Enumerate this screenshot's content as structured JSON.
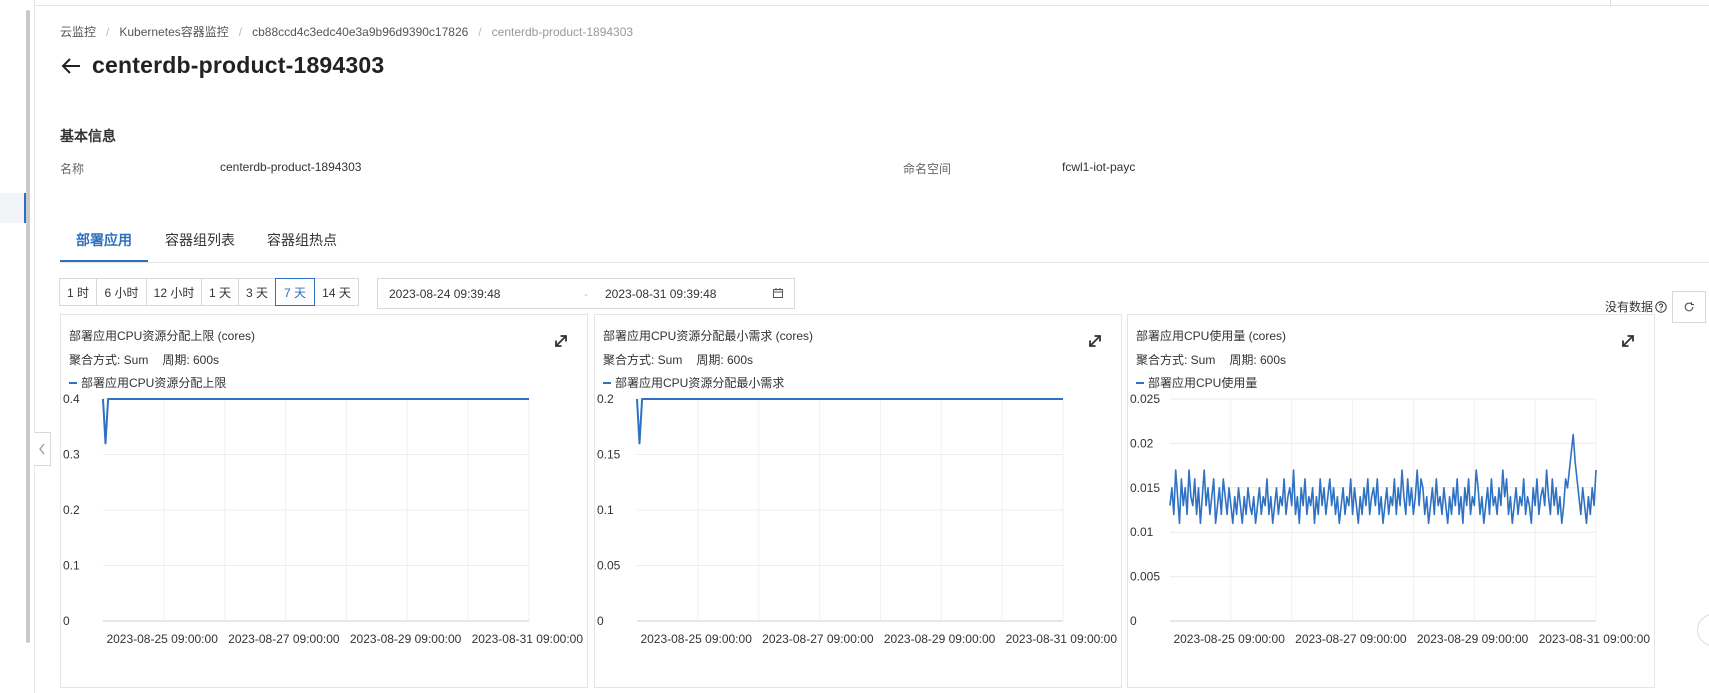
{
  "breadcrumb": [
    "云监控",
    "Kubernetes容器监控",
    "cb88ccd4c3edc40e3a9b96d9390c17826",
    "centerdb-product-1894303"
  ],
  "page_title": "centerdb-product-1894303",
  "basic_info": {
    "section_title": "基本信息",
    "name_label": "名称",
    "name_value": "centerdb-product-1894303",
    "namespace_label": "命名空间",
    "namespace_value": "fcwl1-iot-payc"
  },
  "tabs": [
    "部署应用",
    "容器组列表",
    "容器组热点"
  ],
  "active_tab": 0,
  "time_ranges": [
    "1 时",
    "6 小时",
    "12 小时",
    "1 天",
    "3 天",
    "7 天",
    "14 天"
  ],
  "active_range": 5,
  "date_range": {
    "start": "2023-08-24 09:39:48",
    "separator": "-",
    "end": "2023-08-31 09:39:48"
  },
  "no_data_label": "没有数据",
  "icons": {
    "back": "arrow-left-icon",
    "calendar": "calendar-icon",
    "help": "question-circle-icon",
    "refresh": "refresh-icon",
    "expand": "expand-icon",
    "collapse": "chevron-left-icon"
  },
  "colors": {
    "accent": "#2f6fbf",
    "series": "#2f72c4"
  },
  "chart_data": [
    {
      "type": "line",
      "title": "部署应用CPU资源分配上限 (cores)",
      "aggregation_label": "聚合方式: Sum",
      "period_label": "周期: 600s",
      "series": [
        {
          "name": "部署应用CPU资源分配上限",
          "x": [
            "2023-08-24 09:40:00",
            "2023-08-24 10:40:00",
            "2023-08-24 11:40:00",
            "2023-08-31 09:40:00"
          ],
          "values": [
            0.4,
            0.32,
            0.4,
            0.4
          ]
        }
      ],
      "ylim": [
        0,
        0.4
      ],
      "yticks": [
        "0.4",
        "0.3",
        "0.2",
        "0.1",
        "0"
      ],
      "xticks": [
        "2023-08-25 09:00:00",
        "2023-08-27 09:00:00",
        "2023-08-29 09:00:00",
        "2023-08-31 09:00:00"
      ],
      "grid": true
    },
    {
      "type": "line",
      "title": "部署应用CPU资源分配最小需求 (cores)",
      "aggregation_label": "聚合方式: Sum",
      "period_label": "周期: 600s",
      "series": [
        {
          "name": "部署应用CPU资源分配最小需求",
          "x": [
            "2023-08-24 09:40:00",
            "2023-08-24 10:40:00",
            "2023-08-24 11:40:00",
            "2023-08-31 09:40:00"
          ],
          "values": [
            0.2,
            0.16,
            0.2,
            0.2
          ]
        }
      ],
      "ylim": [
        0,
        0.2
      ],
      "yticks": [
        "0.2",
        "0.15",
        "0.1",
        "0.05",
        "0"
      ],
      "xticks": [
        "2023-08-25 09:00:00",
        "2023-08-27 09:00:00",
        "2023-08-29 09:00:00",
        "2023-08-31 09:00:00"
      ],
      "grid": true
    },
    {
      "type": "line",
      "title": "部署应用CPU使用量 (cores)",
      "aggregation_label": "聚合方式: Sum",
      "period_label": "周期: 600s",
      "series": [
        {
          "name": "部署应用CPU使用量",
          "start": "2023-08-24 09:40:00",
          "end": "2023-08-31 09:40:00",
          "values": [
            0.013,
            0.015,
            0.012,
            0.017,
            0.014,
            0.011,
            0.016,
            0.013,
            0.015,
            0.012,
            0.017,
            0.014,
            0.013,
            0.016,
            0.012,
            0.015,
            0.011,
            0.014,
            0.017,
            0.013,
            0.015,
            0.012,
            0.014,
            0.016,
            0.011,
            0.013,
            0.015,
            0.012,
            0.016,
            0.014,
            0.012,
            0.015,
            0.013,
            0.011,
            0.014,
            0.012,
            0.015,
            0.013,
            0.011,
            0.014,
            0.012,
            0.015,
            0.013,
            0.012,
            0.014,
            0.011,
            0.013,
            0.015,
            0.012,
            0.014,
            0.013,
            0.016,
            0.012,
            0.014,
            0.011,
            0.013,
            0.015,
            0.012,
            0.014,
            0.013,
            0.016,
            0.012,
            0.014,
            0.015,
            0.013,
            0.017,
            0.012,
            0.014,
            0.011,
            0.015,
            0.013,
            0.016,
            0.012,
            0.014,
            0.013,
            0.015,
            0.011,
            0.014,
            0.012,
            0.016,
            0.013,
            0.015,
            0.012,
            0.014,
            0.016,
            0.013,
            0.015,
            0.012,
            0.014,
            0.011,
            0.013,
            0.015,
            0.012,
            0.014,
            0.013,
            0.016,
            0.012,
            0.015,
            0.013,
            0.011,
            0.014,
            0.012,
            0.015,
            0.013,
            0.016,
            0.012,
            0.014,
            0.015,
            0.013,
            0.016,
            0.012,
            0.014,
            0.011,
            0.013,
            0.015,
            0.012,
            0.014,
            0.013,
            0.016,
            0.012,
            0.015,
            0.013,
            0.017,
            0.014,
            0.012,
            0.016,
            0.013,
            0.015,
            0.012,
            0.014,
            0.017,
            0.013,
            0.016,
            0.015,
            0.012,
            0.014,
            0.011,
            0.013,
            0.015,
            0.012,
            0.016,
            0.013,
            0.014,
            0.012,
            0.015,
            0.013,
            0.011,
            0.014,
            0.012,
            0.015,
            0.013,
            0.016,
            0.012,
            0.014,
            0.011,
            0.015,
            0.013,
            0.016,
            0.012,
            0.014,
            0.013,
            0.017,
            0.015,
            0.012,
            0.014,
            0.011,
            0.013,
            0.015,
            0.012,
            0.016,
            0.013,
            0.014,
            0.012,
            0.015,
            0.013,
            0.017,
            0.014,
            0.016,
            0.012,
            0.014,
            0.011,
            0.013,
            0.015,
            0.012,
            0.014,
            0.013,
            0.016,
            0.012,
            0.014,
            0.013,
            0.011,
            0.015,
            0.013,
            0.016,
            0.012,
            0.014,
            0.015,
            0.013,
            0.017,
            0.014,
            0.012,
            0.016,
            0.013,
            0.015,
            0.012,
            0.014,
            0.011,
            0.013,
            0.016,
            0.015,
            0.017,
            0.019,
            0.021,
            0.018,
            0.016,
            0.014,
            0.012,
            0.015,
            0.013,
            0.011,
            0.014,
            0.012,
            0.015,
            0.013,
            0.017
          ]
        }
      ],
      "ylim": [
        0,
        0.025
      ],
      "yticks": [
        "0.025",
        "0.02",
        "0.015",
        "0.01",
        "0.005",
        "0"
      ],
      "xticks": [
        "2023-08-25 09:00:00",
        "2023-08-27 09:00:00",
        "2023-08-29 09:00:00",
        "2023-08-31 09:00:00"
      ],
      "grid": true
    }
  ]
}
